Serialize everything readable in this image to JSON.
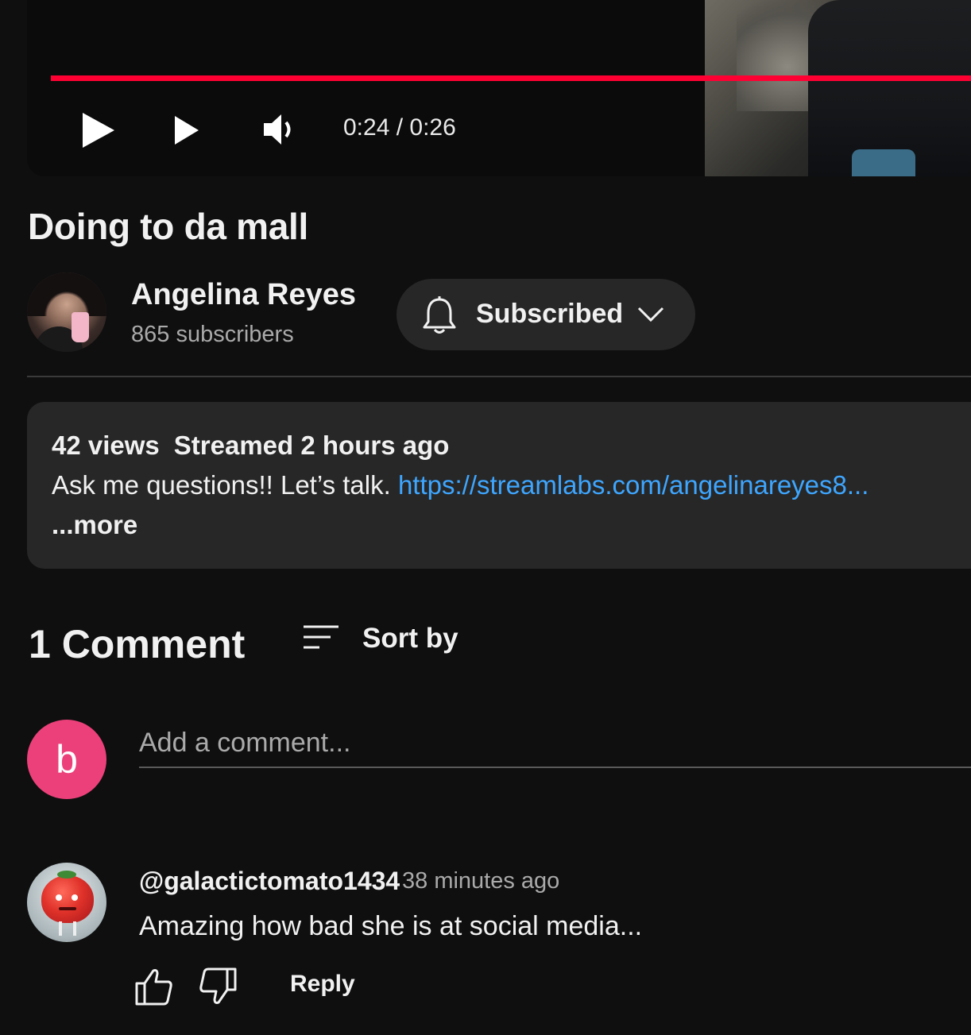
{
  "player": {
    "current_time": "0:24",
    "duration": "0:26",
    "time_display": "0:24 / 0:26",
    "progress_fraction": 0.92,
    "accent_color": "#ff0033",
    "icons": [
      "play-icon",
      "skip-next-icon",
      "volume-icon"
    ]
  },
  "video": {
    "title": "Doing to da mall"
  },
  "channel": {
    "name": "Angelina Reyes",
    "subscribers": "865 subscribers",
    "subscribe_button_label": "Subscribed",
    "icons": [
      "bell-icon",
      "chevron-down-icon"
    ]
  },
  "description": {
    "views": "42 views",
    "streamed": "Streamed 2 hours ago",
    "text": "Ask me questions!! Let’s talk.",
    "link": "https://streamlabs.com/angelinareyes8...",
    "link_color": "#3ea6ff",
    "more_label": "...more"
  },
  "comments": {
    "count_label": "1 Comment",
    "sort_label": "Sort by",
    "add_placeholder": "Add a comment...",
    "user_avatar_letter": "b",
    "user_avatar_color": "#ec407a",
    "items": [
      {
        "author": "@galactictomato1434",
        "time": "38 minutes ago",
        "text": "Amazing how bad she is at social media...",
        "reply_label": "Reply"
      }
    ]
  }
}
